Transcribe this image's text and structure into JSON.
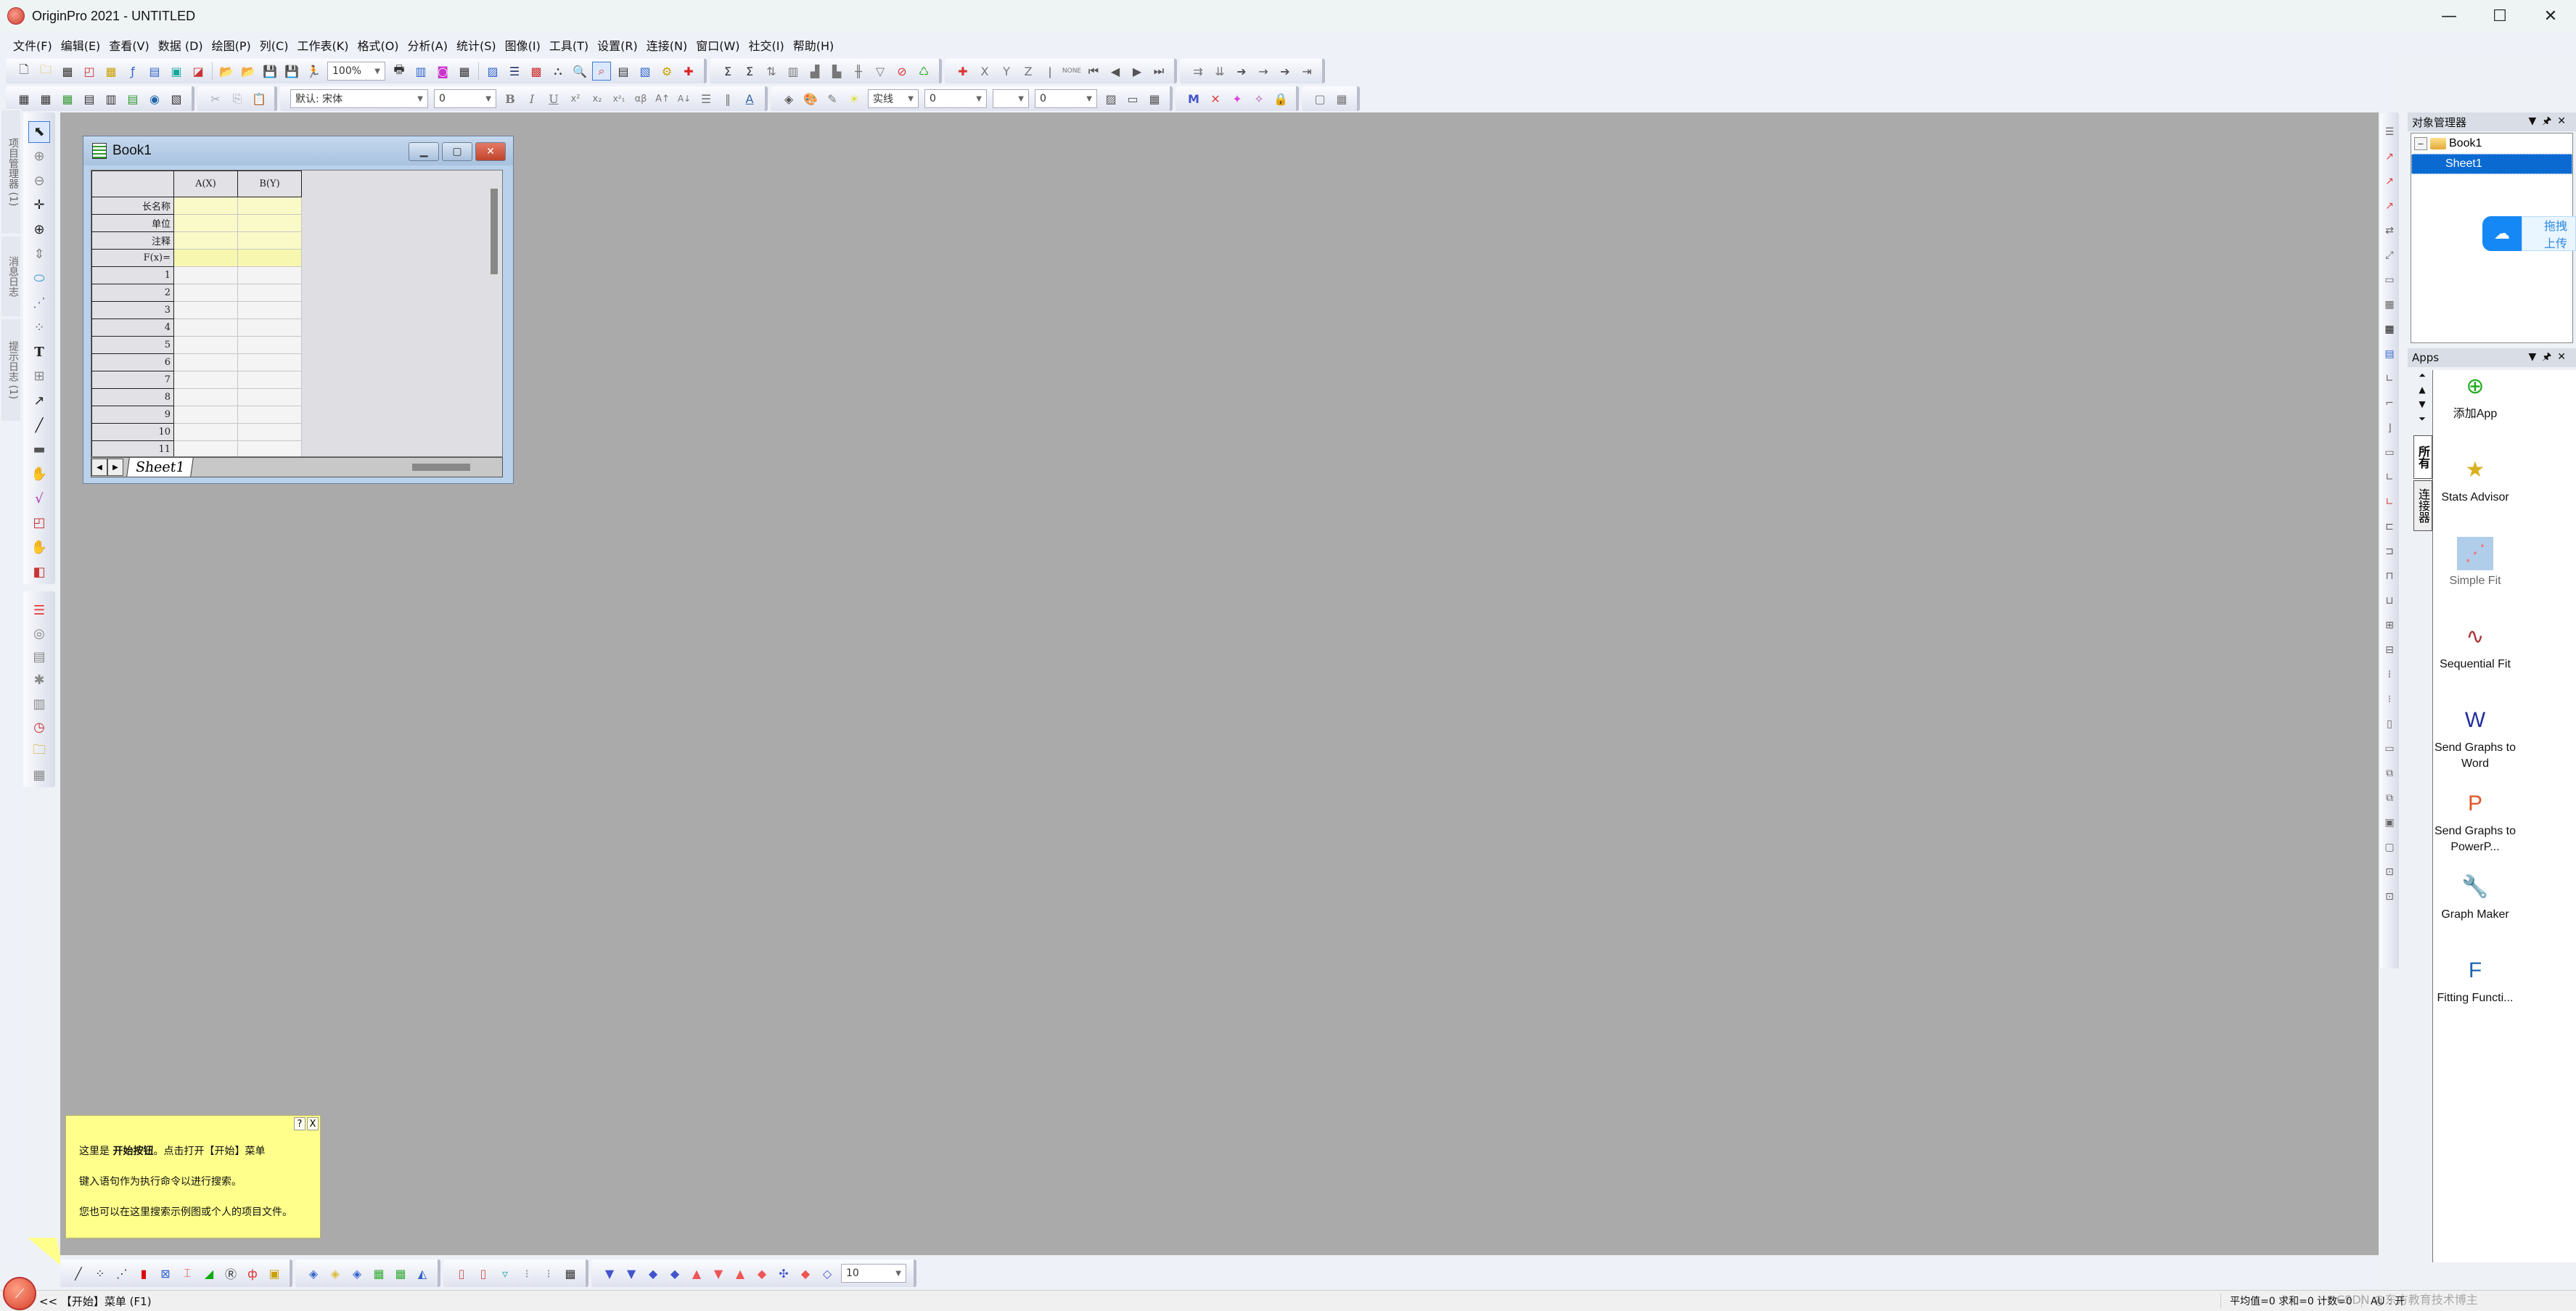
{
  "window": {
    "title": "OriginPro 2021 - UNTITLED",
    "controls": {
      "minimize": "—",
      "maximize": "☐",
      "close": "✕"
    }
  },
  "menubar": {
    "items": [
      "文件(F)",
      "编辑(E)",
      "查看(V)",
      "数据 (D)",
      "绘图(P)",
      "列(C)",
      "工作表(K)",
      "格式(O)",
      "分析(A)",
      "统计(S)",
      "图像(I)",
      "工具(T)",
      "设置(R)",
      "连接(N)",
      "窗口(W)",
      "社交(I)",
      "帮助(H)"
    ]
  },
  "toolbar1": {
    "zoom_value": "100%",
    "icons": [
      "new-project",
      "new-folder",
      "new-workbook",
      "new-graph",
      "new-matrix",
      "new-function",
      "new-layout",
      "new-notes",
      "new-image",
      "open",
      "open-template",
      "save",
      "save-template",
      "run-script",
      "zoom-combo",
      "print",
      "export-ppt",
      "export-image",
      "video",
      "command-window",
      "results-log",
      "data-filter",
      "project-explorer",
      "code-builder",
      "find",
      "graph-browser",
      "sheet-browser",
      "app-gallery",
      "add-column",
      "statistics-columns",
      "statistics-rows",
      "sort",
      "set-column-values",
      "bar-plot",
      "column-plot",
      "stack-plot",
      "filter",
      "clear-filter",
      "reapply-filter",
      "add-error",
      "x-column",
      "y-column",
      "z-column",
      "error-column",
      "none-column",
      "move-first",
      "move-left",
      "move-right",
      "move-last",
      "swap",
      "move-down",
      "arrow-right",
      "arrow-right-small",
      "arrow-right-2",
      "arrow-right-3"
    ],
    "x_label": "X",
    "y_label": "Y",
    "z_label": "Z",
    "none_label": "NONE"
  },
  "toolbar2": {
    "font_name": "默认: 宋体",
    "font_size": "0",
    "line_style_label": "实线",
    "line_width": "0",
    "pattern_value": "0",
    "format_buttons": [
      "B",
      "I",
      "U",
      "x²",
      "x₂",
      "x²₁",
      "αβ",
      "A↑",
      "A↓"
    ]
  },
  "left_tabs": [
    "项目管理器 (1)",
    "消息日志",
    "提示日志 (1)"
  ],
  "left_toolbar": {
    "tools": [
      "pointer",
      "zoom-in",
      "zoom-out",
      "data-reader",
      "screen-reader",
      "data-cursor",
      "region-select",
      "mask",
      "draw-data",
      "text",
      "insert-object",
      "arrow",
      "line",
      "rectangle",
      "hand",
      "insert-equation",
      "insert-graph",
      "hand-pan",
      "3d-rotate"
    ],
    "tools2": [
      "color-map",
      "layer",
      "column-legend",
      "axis-break",
      "table",
      "clock",
      "folder",
      "grid"
    ]
  },
  "book": {
    "title": "Book1",
    "columns": [
      "A(X)",
      "B(Y)"
    ],
    "meta_rows": [
      "长名称",
      "单位",
      "注释",
      "F(x)="
    ],
    "rows": [
      "1",
      "2",
      "3",
      "4",
      "5",
      "6",
      "7",
      "8",
      "9",
      "10",
      "11"
    ],
    "sheet_tab": "Sheet1"
  },
  "object_manager": {
    "title": "对象管理器",
    "tree": [
      {
        "label": "Book1",
        "type": "folder",
        "expanded": true
      },
      {
        "label": "Sheet1",
        "type": "sheet",
        "selected": true
      }
    ]
  },
  "baidu_overlay": {
    "text": "拖拽上传"
  },
  "apps_panel": {
    "title": "Apps",
    "tabs": [
      "所有",
      "连接器"
    ],
    "items": [
      {
        "label": "添加App",
        "icon": "add-app-icon"
      },
      {
        "label": "Stats Advisor",
        "icon": "magic-wand-icon"
      },
      {
        "label": "Simple Fit",
        "icon": "simple-fit-icon",
        "dim": true
      },
      {
        "label": "Sequential Fit",
        "icon": "sequential-fit-icon"
      },
      {
        "label": "Send Graphs to Word",
        "icon": "word-icon"
      },
      {
        "label": "Send Graphs to PowerP...",
        "icon": "powerpoint-icon"
      },
      {
        "label": "Graph Maker",
        "icon": "graph-maker-icon"
      },
      {
        "label": "Fitting Functi...",
        "icon": "fitting-function-icon"
      }
    ]
  },
  "tooltip": {
    "help": "?",
    "close": "X",
    "line1_prefix": "这里是 ",
    "line1_bold": "开始按钮",
    "line1_suffix": "。点击打开【开始】菜单",
    "line2": "键入语句作为执行命令以进行搜索。",
    "line3": "您也可以在这里搜索示例图或个人的项目文件。"
  },
  "bottom_toolbar": {
    "font_size_value": "10"
  },
  "statusbar": {
    "left": "<<  【开始】菜单 (F1)",
    "stats": "平均值=0 求和=0 计数=0",
    "au": "AU : 开",
    "watermark": "CSDN @东方教育技术博主"
  }
}
